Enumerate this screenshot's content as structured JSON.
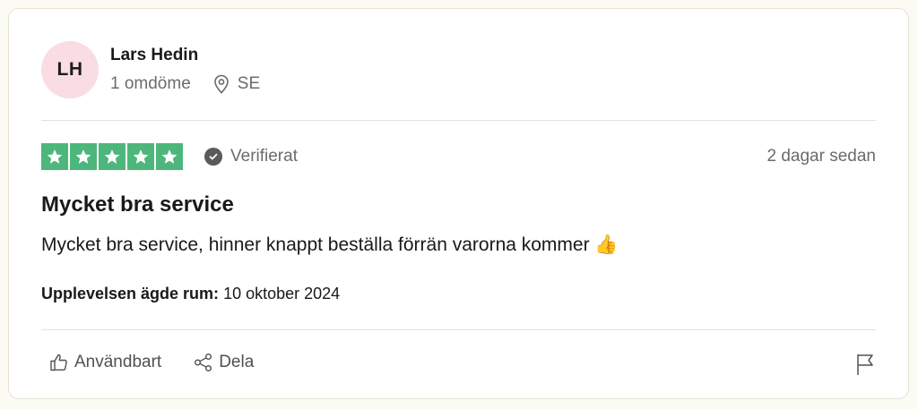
{
  "consumer": {
    "initials": "LH",
    "name": "Lars Hedin",
    "review_count": "1 omdöme",
    "country": "SE",
    "avatar_color": "#f9dde3"
  },
  "review": {
    "rating": 5,
    "rating_max": 5,
    "star_color": "#4db67b",
    "verified_label": "Verifierat",
    "date": "2 dagar sedan",
    "title": "Mycket bra service",
    "text": "Mycket bra service, hinner knappt beställa förrän varorna kommer 👍",
    "experience_label": "Upplevelsen ägde rum:",
    "experience_date": "10 oktober 2024"
  },
  "actions": {
    "useful_label": "Användbart",
    "share_label": "Dela",
    "icons": [
      "thumbs-up-icon",
      "share-icon",
      "flag-icon"
    ]
  }
}
